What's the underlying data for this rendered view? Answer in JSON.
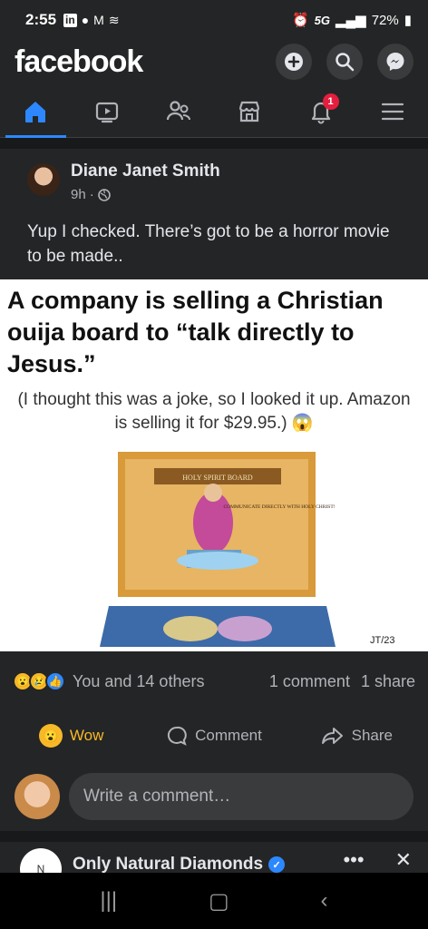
{
  "status_bar": {
    "time": "2:55",
    "network": "5G",
    "battery": "72%"
  },
  "header": {
    "logo": "facebook",
    "buttons": [
      "add-icon",
      "search-icon",
      "messenger-icon"
    ]
  },
  "nav": {
    "tabs": [
      "home",
      "watch",
      "friends",
      "marketplace",
      "notifications",
      "menu"
    ],
    "active": "home",
    "notification_count": "1"
  },
  "post": {
    "author": "Diane Janet Smith",
    "time": "9h",
    "privacy_icon": "globe-icon",
    "text": "Yup I checked. There’s got to be a horror movie to be made..",
    "image": {
      "headline": "A company is selling a Christian ouija board to “talk directly to Jesus.”",
      "subtext": "(I thought this was a joke, so I looked it up. Amazon is selling it for $29.95.) 😱",
      "board_title": "HOLY SPIRIT BOARD",
      "board_tagline": "COMMUNICATE DIRECTLY WITH HOLY CHRIST!",
      "credit": "JT/23"
    },
    "reactions": {
      "emojis": [
        "wow",
        "sad",
        "like"
      ],
      "summary": "You and 14 others",
      "comments": "1 comment",
      "shares": "1 share"
    },
    "actions": {
      "react": "Wow",
      "comment": "Comment",
      "share": "Share"
    },
    "comment_placeholder": "Write a comment…"
  },
  "next_post": {
    "author": "Only Natural Diamonds",
    "more_icon": "more-icon",
    "close_icon": "close-icon"
  },
  "colors": {
    "background": "#242526",
    "accent": "#2d88ff",
    "wow": "#f7b928",
    "badge": "#e41e3f"
  }
}
